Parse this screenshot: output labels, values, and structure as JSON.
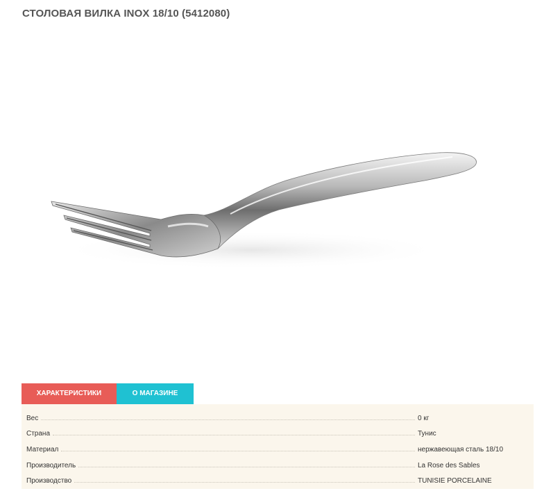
{
  "product": {
    "title": "СТОЛОВАЯ ВИЛКА INOX 18/10 (5412080)"
  },
  "tabs": [
    {
      "label": "ХАРАКТЕРИСТИКИ",
      "color": "#e85c57",
      "active": true
    },
    {
      "label": "О МАГАЗИНЕ",
      "color": "#1fc1d2",
      "active": false
    }
  ],
  "specs": [
    {
      "label": "Вес",
      "value": "0 кг"
    },
    {
      "label": "Страна",
      "value": "Тунис"
    },
    {
      "label": "Материал",
      "value": "нержавеющая сталь 18/10"
    },
    {
      "label": "Производитель",
      "value": "La Rose des Sables"
    },
    {
      "label": "Производство",
      "value": "TUNISIE PORCELAINE"
    }
  ],
  "colors": {
    "title": "#555555",
    "specs_background": "#fbf6ec"
  }
}
